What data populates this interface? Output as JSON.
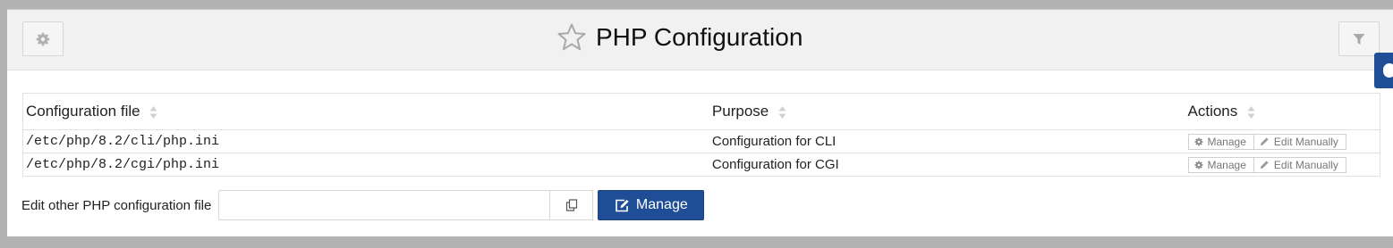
{
  "header": {
    "title": "PHP Configuration",
    "gear_icon": "gear-icon",
    "filter_icon": "filter-icon",
    "star_icon": "star-outline-icon"
  },
  "table": {
    "columns": [
      "Configuration file",
      "Purpose",
      "Actions"
    ],
    "rows": [
      {
        "file": "/etc/php/8.2/cli/php.ini",
        "purpose": "Configuration for CLI",
        "actions": [
          "Manage",
          "Edit Manually"
        ]
      },
      {
        "file": "/etc/php/8.2/cgi/php.ini",
        "purpose": "Configuration for CGI",
        "actions": [
          "Manage",
          "Edit Manually"
        ]
      }
    ]
  },
  "other": {
    "label": "Edit other PHP configuration file",
    "input_value": "",
    "button_label": "Manage"
  },
  "colors": {
    "accent": "#1f4e96",
    "header_bg": "#f1f1f1",
    "page_bg": "#b3b3b3"
  }
}
